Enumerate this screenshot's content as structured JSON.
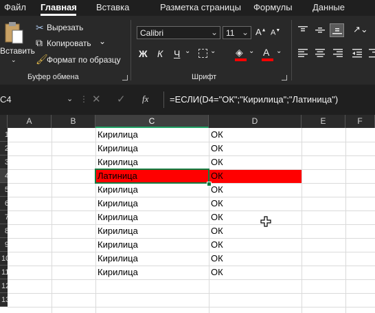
{
  "tabs": [
    "Файл",
    "Главная",
    "Вставка",
    "Разметка страницы",
    "Формулы",
    "Данные"
  ],
  "clipboard": {
    "paste_label": "Вставить",
    "cut_label": "Вырезать",
    "copy_label": "Копировать",
    "format_painter_label": "Формат по образцу",
    "group_label": "Буфер обмена"
  },
  "font": {
    "name": "Calibri",
    "size": "11",
    "bold": "Ж",
    "italic": "К",
    "underline": "Ч",
    "fill_color": "#ff0000",
    "font_color": "#ff0000",
    "group_label": "Шрифт"
  },
  "formula_bar": {
    "name_box": "C4",
    "fx": "fx",
    "formula": "=ЕСЛИ(D4=\"ОК\";\"Кирилица\";\"Латиница\")"
  },
  "sheet": {
    "columns": [
      "A",
      "B",
      "C",
      "D",
      "E",
      "F"
    ],
    "selected_column": "C",
    "row_numbers": [
      "1",
      "2",
      "3",
      "4",
      "5",
      "6",
      "7",
      "8",
      "9",
      "10",
      "11",
      "12",
      "13"
    ],
    "highlight_color": "#ff0000",
    "rows": [
      {
        "c": "Кирилица",
        "d": "ОК"
      },
      {
        "c": "Кирилица",
        "d": "ОК"
      },
      {
        "c": "Латиница",
        "d": "ОК",
        "highlight": true
      },
      {
        "c": "Кирилица",
        "d": "ОК"
      },
      {
        "c": "Кирилица",
        "d": "ОК"
      },
      {
        "c": "Кирилица",
        "d": "ОК"
      },
      {
        "c": "Кирилица",
        "d": "ОК"
      },
      {
        "c": "Кирилица",
        "d": "ОК"
      },
      {
        "c": "Кирилица",
        "d": "ОК"
      },
      {
        "c": "Кирилица",
        "d": "ОК"
      }
    ]
  }
}
